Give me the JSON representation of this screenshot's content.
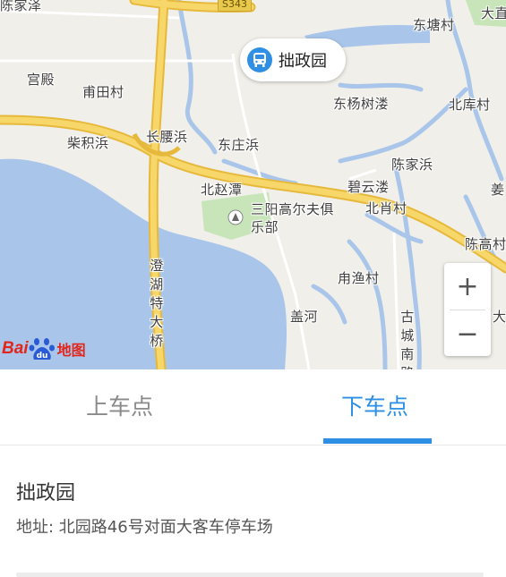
{
  "map": {
    "place_labels": [
      {
        "id": "chenjiajin",
        "text": "陈家泽"
      },
      {
        "id": "gongdian",
        "text": "宫殿"
      },
      {
        "id": "futiancun",
        "text": "甫田村"
      },
      {
        "id": "chaijibang",
        "text": "柴积浜"
      },
      {
        "id": "changyaobang",
        "text": "长腰浜"
      },
      {
        "id": "dongzhuangbang",
        "text": "东庄浜"
      },
      {
        "id": "beizhaotan",
        "text": "北赵潭"
      },
      {
        "id": "dongtangcun",
        "text": "东塘村"
      },
      {
        "id": "dongyangshulou",
        "text": "东杨树溇"
      },
      {
        "id": "beikucun",
        "text": "北库村"
      },
      {
        "id": "chenjiabang",
        "text": "陈家浜"
      },
      {
        "id": "biyunlou",
        "text": "碧云溇"
      },
      {
        "id": "beixiaocun",
        "text": "北肖村"
      },
      {
        "id": "chengaocun",
        "text": "陈高村"
      },
      {
        "id": "yongyucun",
        "text": "甪渔村"
      },
      {
        "id": "gaihe",
        "text": "盖河"
      },
      {
        "id": "dagu",
        "text": "大直"
      },
      {
        "id": "jiang",
        "text": "姜"
      },
      {
        "id": "da2",
        "text": "大"
      }
    ],
    "golf_club": "三阳高尔夫俱乐部",
    "bridge": "澄湖特大桥",
    "road_gucheng": "古城南路",
    "highway_badge": "S343",
    "marker": {
      "label": "拙政园",
      "icon": "bus-icon",
      "color": "#2f8fe4"
    },
    "zoom_in": "+",
    "zoom_out": "−",
    "logo": {
      "bai": "Bai",
      "du": "du",
      "suffix": "地图"
    }
  },
  "tabs": [
    {
      "label": "上车点",
      "active": false
    },
    {
      "label": "下车点",
      "active": true
    }
  ],
  "stop": {
    "name": "拙政园",
    "address": "地址: 北园路46号对面大客车停车场"
  },
  "colors": {
    "accent": "#2d8fe3",
    "water": "#a9c6ea",
    "road": "#f5cd59",
    "green": "#c7e5b8"
  }
}
